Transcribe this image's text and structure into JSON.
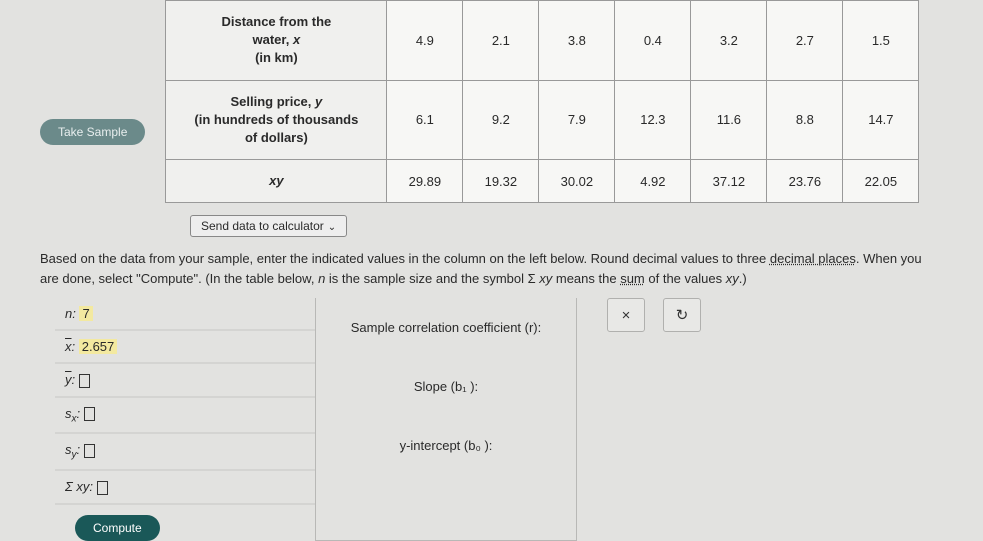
{
  "take_sample": "Take Sample",
  "headers": {
    "row1": "Distance from the water, x (in km)",
    "row1_line1": "Distance from the",
    "row1_line2": "water, ",
    "row1_line3": "(in km)",
    "row2": "Selling price, y (in hundreds of thousands of dollars)",
    "row2_line1": "Selling price, ",
    "row2_line2": "(in hundreds of thousands",
    "row2_line3": "of dollars)",
    "row3": "xy"
  },
  "data": {
    "x": [
      "4.9",
      "2.1",
      "3.8",
      "0.4",
      "3.2",
      "2.7",
      "1.5"
    ],
    "y": [
      "6.1",
      "9.2",
      "7.9",
      "12.3",
      "11.6",
      "8.8",
      "14.7"
    ],
    "xy": [
      "29.89",
      "19.32",
      "30.02",
      "4.92",
      "37.12",
      "23.76",
      "22.05"
    ]
  },
  "send_data": "Send data to calculator",
  "instructions_1": "Based on the data from your sample, enter the indicated values in the column on the left below. Round decimal values to three ",
  "instructions_dec": "decimal places",
  "instructions_2": ". When you are done, select \"Compute\". (In the table below, ",
  "instructions_3": " is the sample size and the symbol Σ ",
  "instructions_4": " means the ",
  "instructions_sum": "sum",
  "instructions_5": " of the values ",
  "instructions_6": ".)",
  "stats": {
    "n_label": "n: ",
    "n_val": "7",
    "xbar_label": "x",
    "xbar_val": "2.657",
    "ybar_label": "y",
    "sx_label": "s",
    "sx_sub": "x",
    "sy_label": "s",
    "sy_sub": "y",
    "sigmaxy_label": "Σ xy: "
  },
  "results": {
    "r": "Sample correlation coefficient (r):",
    "slope": "Slope (b₁ ):",
    "intercept": "y-intercept (b₀ ):"
  },
  "compute": "Compute",
  "ctrl_x": "×",
  "ctrl_reset": "↻"
}
